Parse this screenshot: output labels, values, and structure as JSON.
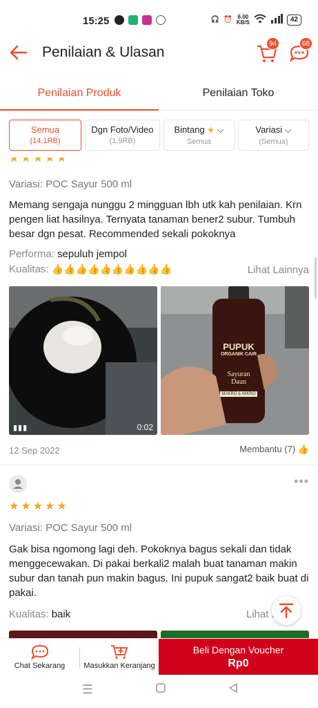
{
  "status": {
    "time": "15:25",
    "net_speed_value": "6.00",
    "net_speed_unit": "KB/S",
    "battery": "42"
  },
  "header": {
    "title": "Penilaian & Ulasan",
    "cart_count": "94",
    "chat_count": "68"
  },
  "tabs": [
    {
      "label": "Penilaian Produk"
    },
    {
      "label": "Penilaian Toko"
    }
  ],
  "filters": [
    {
      "label": "Semua",
      "sub": "(14,1RB)"
    },
    {
      "label": "Dgn Foto/Video",
      "sub": "(1,9RB)"
    },
    {
      "label": "Bintang",
      "sub": "Semua"
    },
    {
      "label": "Variasi",
      "sub": "(Semua)"
    }
  ],
  "reviews": [
    {
      "variant": "Variasi: POC Sayur 500 ml",
      "text": "Memang sengaja nunggu 2 mingguan lbh utk kah penilaian. Krn pengen liat hasilnya. Ternyata tanaman bener2 subur. Tumbuh besar dgn pesat. Recommended sekali pokoknya",
      "performa_label": "Performa:",
      "performa_value": "sepuluh jempol",
      "kualitas_label": "Kualitas:",
      "kualitas_value": "👍👍👍👍👍👍👍👍👍👍",
      "see_more": "Lihat Lainnya",
      "video_duration": "0:02",
      "bottle_brand": "PUPUK",
      "bottle_line2": "ORGANIK CAIR",
      "bottle_line3": "Sayuran",
      "bottle_line4": "Daun",
      "bottle_line5": "MAKRO & MIKRO",
      "date": "12 Sep 2022",
      "helpful": "Membantu (7)"
    },
    {
      "variant": "Variasi: POC Sayur 500 ml",
      "text": "Gak bisa ngomong lagi deh. Pokoknya bagus sekali dan tidak menggecewakan. Di pakai berkali2 malah buat tanaman makin subur dan tanah pun makin bagus. Ini pupuk sangat2 baik buat di pakai.",
      "kualitas_label": "Kualitas:",
      "kualitas_value": "baik",
      "see_more": "Lihat L"
    }
  ],
  "bottom": {
    "chat": "Chat Sekarang",
    "cart": "Masukkan Keranjang",
    "buy_line1": "Beli Dengan Voucher",
    "buy_line2": "Rp0"
  },
  "colors": {
    "accent": "#ee4d2d",
    "buy": "#d0011b",
    "star": "#f5a623"
  }
}
